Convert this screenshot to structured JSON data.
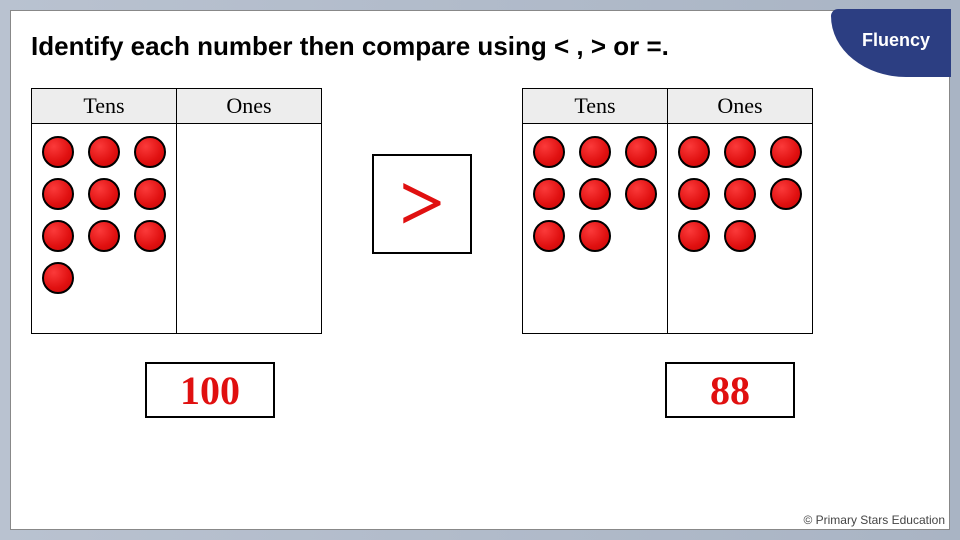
{
  "badge": "Fluency",
  "instruction": "Identify each number then compare using < , > or =.",
  "headers": {
    "tens": "Tens",
    "ones": "Ones"
  },
  "left": {
    "tens_dots": 10,
    "ones_dots": 0,
    "value": "100"
  },
  "compare_symbol": ">",
  "right": {
    "tens_dots": 8,
    "ones_dots": 8,
    "value": "88"
  },
  "footer": "© Primary Stars Education",
  "chart_data": {
    "type": "table",
    "description": "Place-value dot charts comparing two numbers",
    "left_number": {
      "tens": 10,
      "ones": 0,
      "total": 100
    },
    "right_number": {
      "tens": 8,
      "ones": 8,
      "total": 88
    },
    "comparison": "100 > 88"
  }
}
